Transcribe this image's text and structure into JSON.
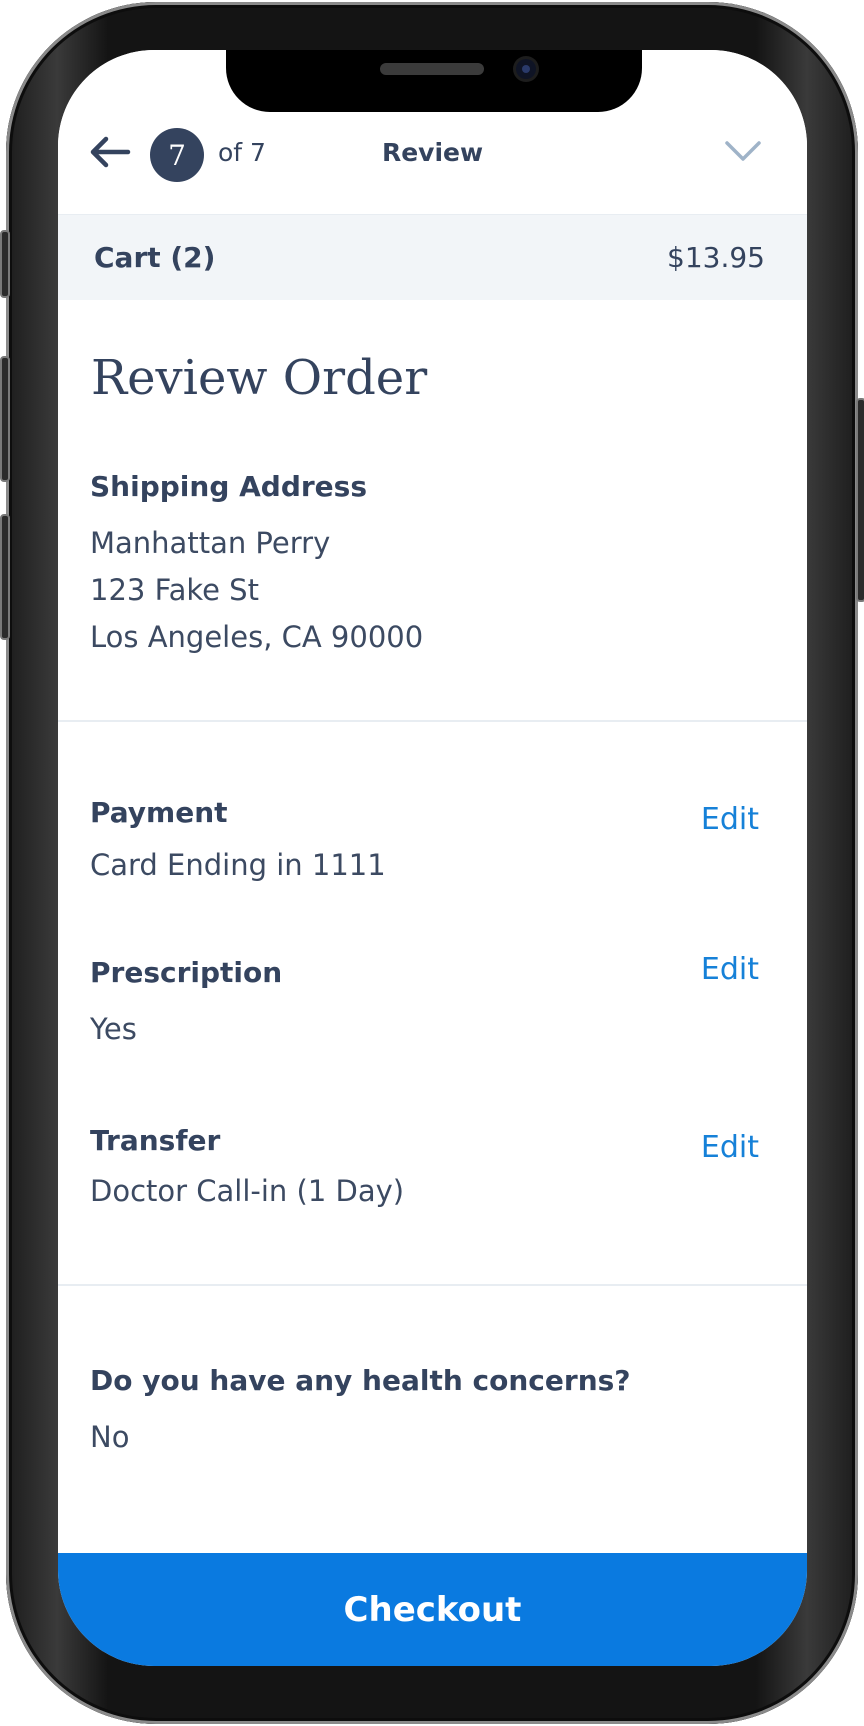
{
  "header": {
    "step_number": "7",
    "step_of": "of 7",
    "title": "Review",
    "back_icon": "arrow-left-icon",
    "collapse_icon": "chevron-down-icon"
  },
  "cart": {
    "label": "Cart (2)",
    "total": "$13.95"
  },
  "page_title": "Review Order",
  "shipping": {
    "heading": "Shipping Address",
    "name": "Manhattan Perry",
    "street": "123 Fake St",
    "city": "Los Angeles, CA 90000"
  },
  "payment": {
    "heading": "Payment",
    "value": "Card Ending in 1111",
    "edit_label": "Edit"
  },
  "prescription": {
    "heading": "Prescription",
    "value": "Yes",
    "edit_label": "Edit"
  },
  "transfer": {
    "heading": "Transfer",
    "value": "Doctor Call-in (1 Day)",
    "edit_label": "Edit"
  },
  "health": {
    "question": "Do you have any health concerns?",
    "answer": "No"
  },
  "checkout_label": "Checkout",
  "colors": {
    "text": "#34435e",
    "accent": "#0a7ae0",
    "link": "#1681d8",
    "cart_bg": "#f2f5f8"
  }
}
